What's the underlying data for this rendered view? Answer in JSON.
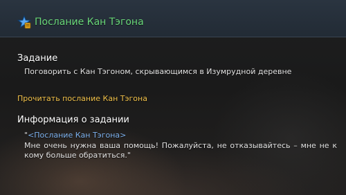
{
  "quest": {
    "title": "Послание Кан Тэгона",
    "icon": "blue-star-quest-icon"
  },
  "task_section": {
    "heading": "Задание",
    "description": "Поговорить с Кан Тэгоном, скрывающимся в Изумрудной деревне"
  },
  "read_link": {
    "label": "Прочитать послание Кан Тэгона"
  },
  "info_section": {
    "heading": "Информация о задании",
    "open_quote": "\"",
    "letter_title": "<Послание Кан Тэгона>",
    "letter_body": "Мне очень нужна ваша помощь! Пожалуйста, не отказывайтесь – мне не к кому больше обратиться.\""
  },
  "colors": {
    "title_green": "#6ad87a",
    "link_gold": "#f2c24a",
    "letter_title_blue": "#7fb3ef"
  }
}
